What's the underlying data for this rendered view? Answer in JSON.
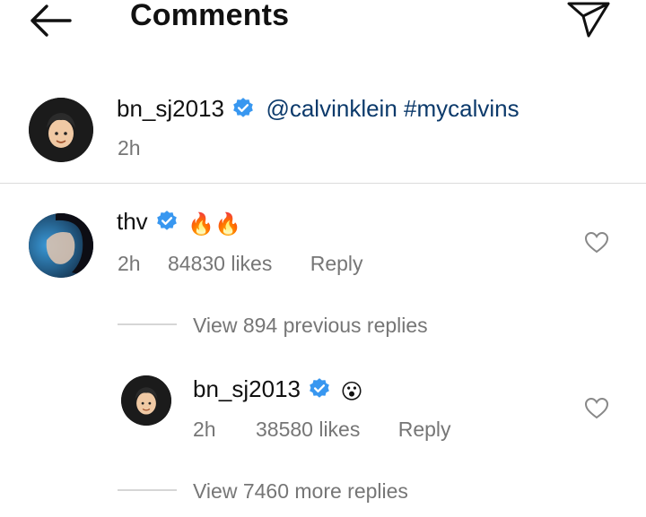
{
  "header": {
    "title": "Comments"
  },
  "caption": {
    "username": "bn_sj2013",
    "text": "@calvinklein #mycalvins",
    "time": "2h"
  },
  "comment": {
    "username": "thv",
    "text": "🔥🔥",
    "time": "2h",
    "likes": "84830 likes",
    "reply_label": "Reply"
  },
  "view_previous": "View 894 previous replies",
  "reply": {
    "username": "bn_sj2013",
    "text": "😮",
    "time": "2h",
    "likes": "38580 likes",
    "reply_label": "Reply"
  },
  "view_more": "View 7460 more replies",
  "colors": {
    "verified": "#3897f0",
    "link": "#0c3a6b",
    "muted": "#767676"
  }
}
